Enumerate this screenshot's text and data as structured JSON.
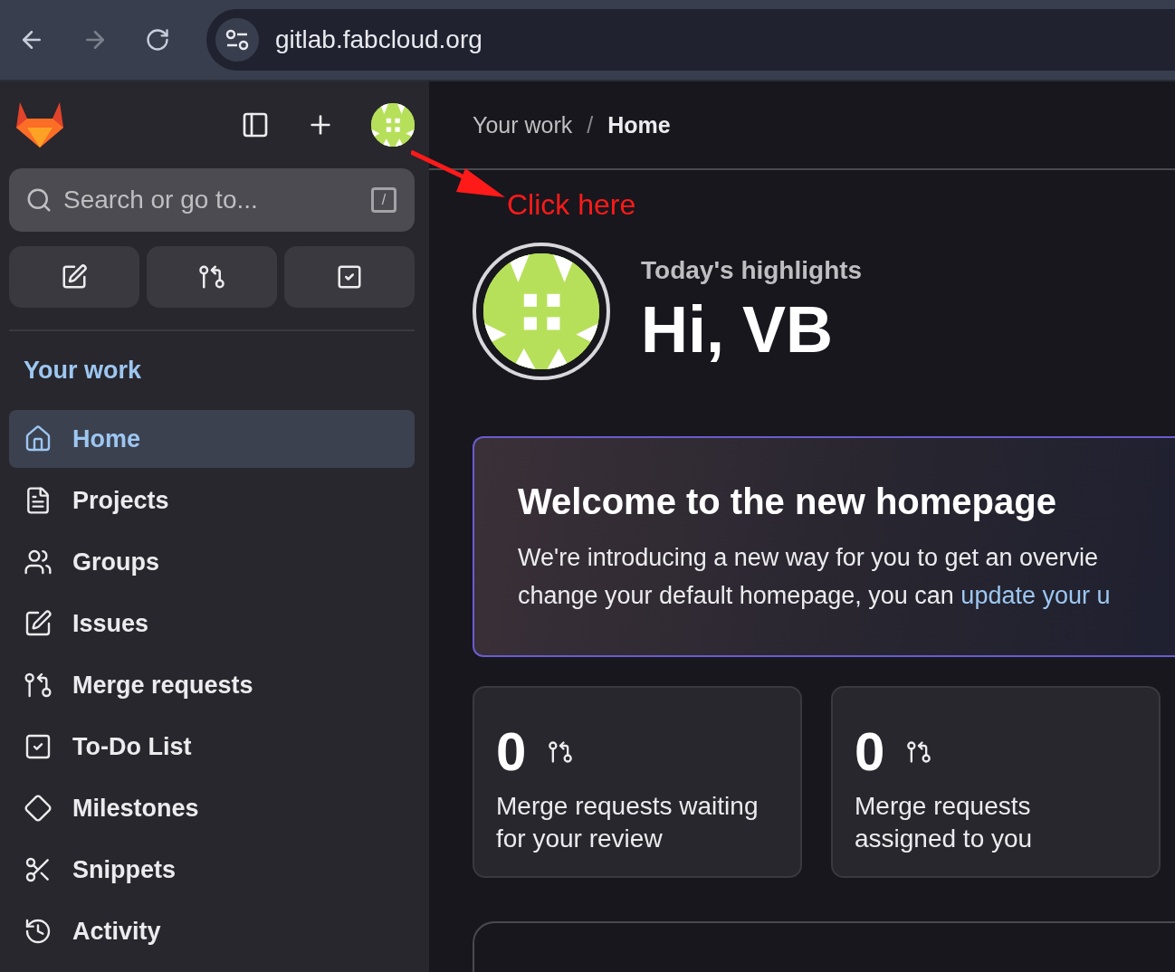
{
  "browser": {
    "url": "gitlab.fabcloud.org"
  },
  "sidebar": {
    "search": {
      "placeholder": "Search or go to...",
      "shortcut": "/"
    },
    "section_title": "Your work",
    "items": [
      {
        "label": "Home",
        "selected": true
      },
      {
        "label": "Projects",
        "selected": false
      },
      {
        "label": "Groups",
        "selected": false
      },
      {
        "label": "Issues",
        "selected": false
      },
      {
        "label": "Merge requests",
        "selected": false
      },
      {
        "label": "To-Do List",
        "selected": false
      },
      {
        "label": "Milestones",
        "selected": false
      },
      {
        "label": "Snippets",
        "selected": false
      },
      {
        "label": "Activity",
        "selected": false
      }
    ]
  },
  "breadcrumb_separator": "/",
  "breadcrumbs": [
    {
      "label": "Your work",
      "current": false
    },
    {
      "label": "Home",
      "current": true
    }
  ],
  "annotation": {
    "text": "Click here"
  },
  "greeting": {
    "subtitle": "Today's highlights",
    "title": "Hi, VB"
  },
  "banner": {
    "title": "Welcome to the new homepage",
    "line_1": "We're introducing a new way for you to get an overvie",
    "line_2": "change your default homepage, you can ",
    "link": "update your u"
  },
  "stats": [
    {
      "count": "0",
      "label": "Merge requests waiting for your review"
    },
    {
      "count": "0",
      "label": "Merge requests assigned to you"
    }
  ]
}
